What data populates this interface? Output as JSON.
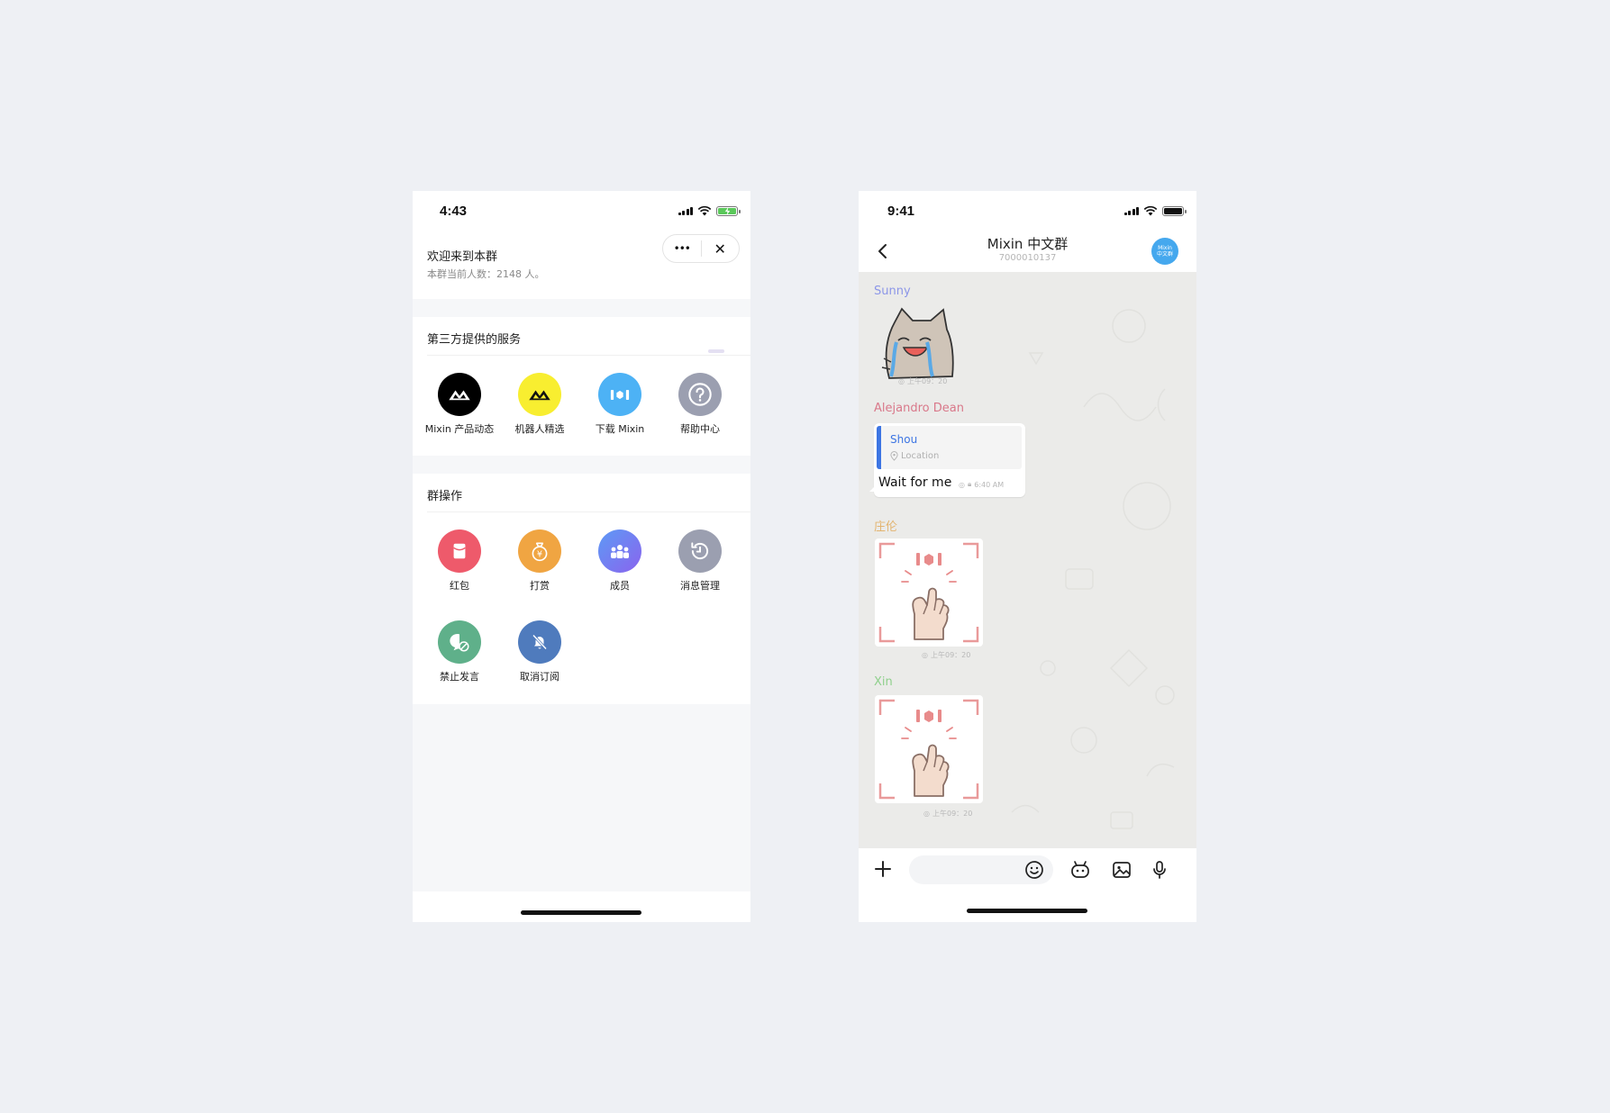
{
  "left_screen": {
    "status": {
      "time": "4:43"
    },
    "header": {
      "title": "欢迎来到本群",
      "subtitle": "本群当前人数：2148 人。"
    },
    "capsule": {
      "more_label": "•••",
      "close_label": "✕"
    },
    "services": {
      "title": "第三方提供的服务",
      "items": [
        {
          "label": "Mixin 产品动态",
          "icon": "mixin-logo-icon",
          "color": "#000000"
        },
        {
          "label": "机器人精选",
          "icon": "mixin-logo-icon",
          "color": "#f8ee30"
        },
        {
          "label": "下载 Mixin",
          "icon": "mixin-download-icon",
          "color": "#4db2f5"
        },
        {
          "label": "帮助中心",
          "icon": "help-icon",
          "color": "#9b9fb0"
        }
      ]
    },
    "group_ops": {
      "title": "群操作",
      "items": [
        {
          "label": "红包",
          "icon": "red-packet-icon",
          "color": "#ee5a6b"
        },
        {
          "label": "打赏",
          "icon": "reward-bag-icon",
          "color": "#f0a542"
        },
        {
          "label": "成员",
          "icon": "members-icon",
          "color": "#6f7ef0"
        },
        {
          "label": "消息管理",
          "icon": "history-icon",
          "color": "#9b9fb0"
        },
        {
          "label": "禁止发言",
          "icon": "mute-chat-icon",
          "color": "#5fb08a"
        },
        {
          "label": "取消订阅",
          "icon": "bell-off-icon",
          "color": "#4f7bbd"
        }
      ]
    }
  },
  "right_screen": {
    "status": {
      "time": "9:41"
    },
    "nav": {
      "title": "Mixin 中文群",
      "subtitle": "7000010137",
      "avatar_line1": "Mixin",
      "avatar_line2": "中文群"
    },
    "messages": [
      {
        "sender": "Sunny",
        "sender_color": "#8c96e8",
        "type": "sticker",
        "sticker": "crying-cat-sticker",
        "time": "上午09：20"
      },
      {
        "sender": "Alejandro Dean",
        "sender_color": "#d9788a",
        "type": "text",
        "quote_name": "Shou",
        "quote_location": "Location",
        "text": "Wait for me",
        "time": "6:40 AM"
      },
      {
        "sender": "庄伦",
        "sender_color": "#e3b470",
        "type": "sticker",
        "sticker": "finger-heart-sticker",
        "time": "上午09：20"
      },
      {
        "sender": "Xin",
        "sender_color": "#8fd08c",
        "type": "sticker",
        "sticker": "finger-heart-sticker",
        "time": "上午09：20"
      }
    ]
  }
}
